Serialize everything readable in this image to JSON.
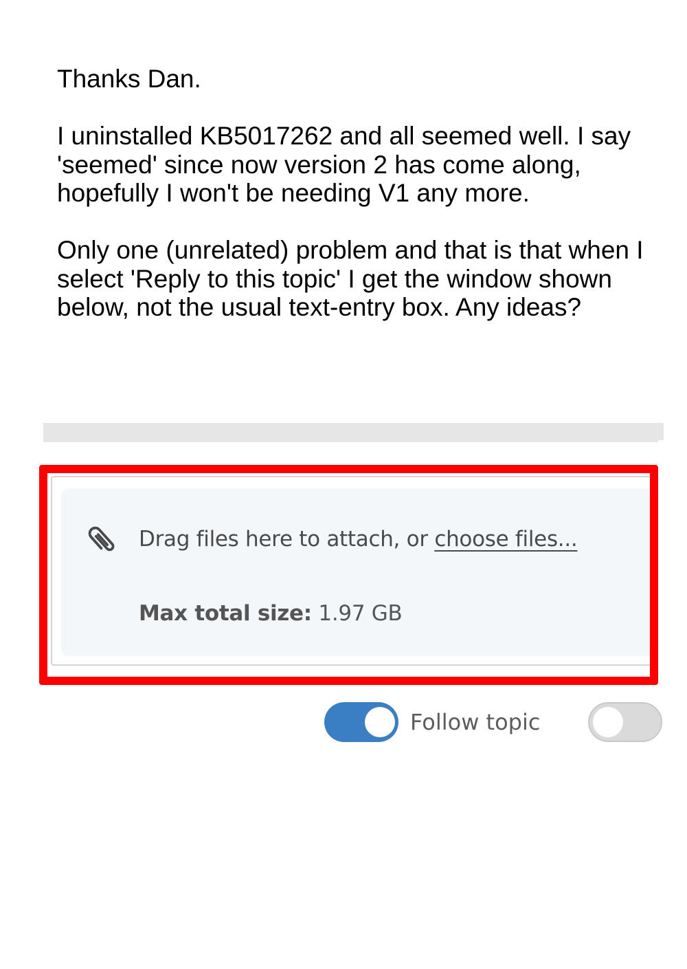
{
  "post": {
    "paragraphs": [
      "Thanks Dan.",
      "I uninstalled KB5017262 and all seemed well. I say 'seemed' since now version 2 has come along, hopefully I won't be needing V1 any more.",
      "Only one (unrelated) problem and that is that when I select 'Reply to this topic' I get the window shown below, not the usual text-entry box. Any ideas?"
    ]
  },
  "editor": {
    "attach_icon": "paperclip-icon",
    "drop_text": "Drag files here to attach, or ",
    "choose_files_link": "choose files...",
    "max_size_label": "Max total size:",
    "max_size_value": " 1.97 GB"
  },
  "toggles": {
    "follow_topic": {
      "label": "Follow topic",
      "checked": true
    },
    "second_toggle": {
      "checked": false
    }
  },
  "colors": {
    "highlight_border": "#ff0000",
    "toggle_on": "#3a7ec4",
    "toggle_off": "#dadada",
    "dropzone_bg": "#f4f7fa"
  }
}
